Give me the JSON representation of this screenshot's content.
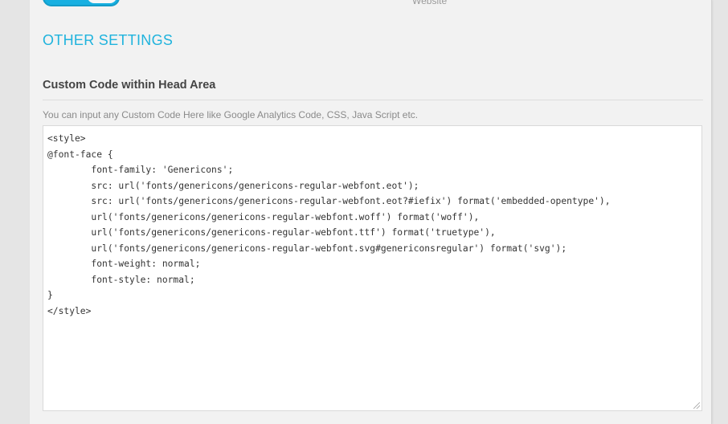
{
  "toggle": {
    "state": "on"
  },
  "previous_field": {
    "text": "Website"
  },
  "section": {
    "title": "OTHER SETTINGS"
  },
  "field": {
    "label": "Custom Code within Head Area",
    "help": "You can input any Custom Code Here like Google Analytics Code, CSS, Java Script etc."
  },
  "code": {
    "lines": [
      "<style>",
      "@font-face {",
      "        font-family: 'Genericons';",
      "        src: url('fonts/genericons/genericons-regular-webfont.eot');",
      "        src: url('fonts/genericons/genericons-regular-webfont.eot?#iefix') format('embedded-opentype'),",
      "        url('fonts/genericons/genericons-regular-webfont.woff') format('woff'),",
      "        url('fonts/genericons/genericons-regular-webfont.ttf') format('truetype'),",
      "        url('fonts/genericons/genericons-regular-webfont.svg#genericonsregular') format('svg');",
      "        font-weight: normal;",
      "        font-style: normal;",
      "}",
      "</style>"
    ]
  },
  "colors": {
    "accent": "#1fb3dd",
    "toggle": "#18b0e1",
    "background": "#f2f2f2"
  }
}
